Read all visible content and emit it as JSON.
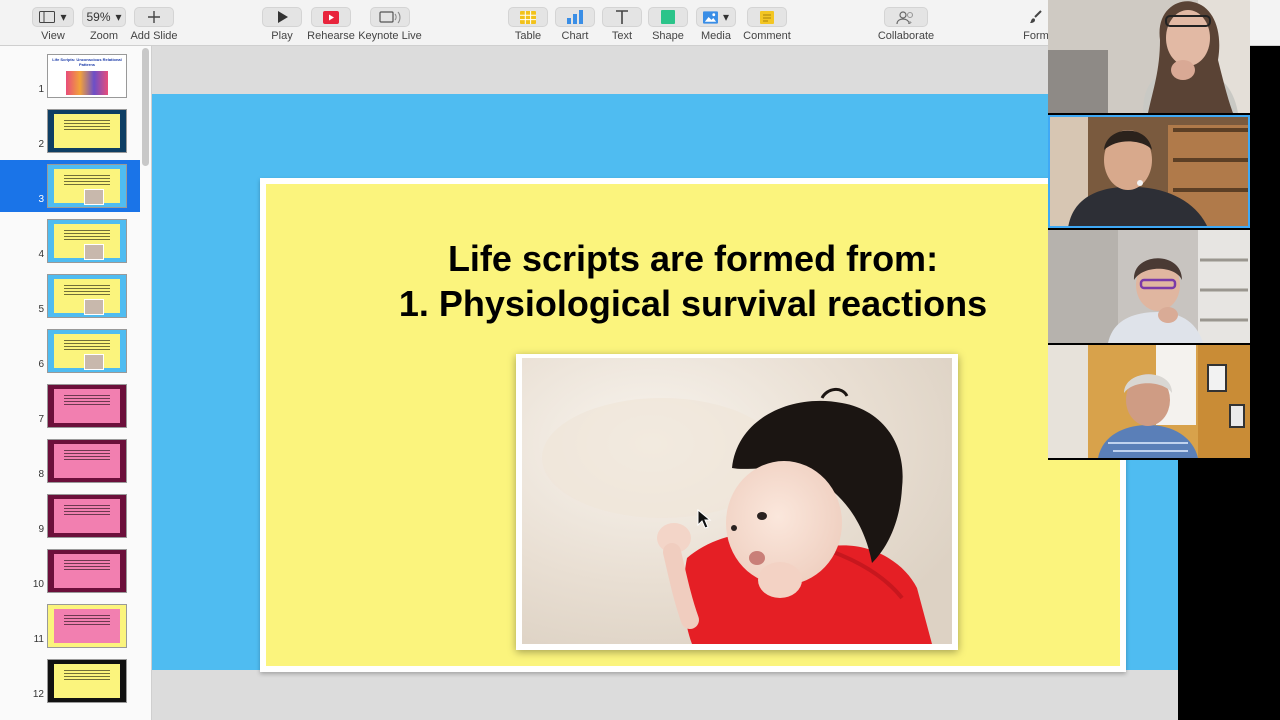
{
  "toolbar": {
    "view": {
      "label": "View",
      "icon": "sidebar-view-icon"
    },
    "zoom": {
      "label": "Zoom",
      "value": "59%",
      "icon": "chevron-down-icon"
    },
    "add_slide": {
      "label": "Add Slide",
      "icon": "plus-icon"
    },
    "play": {
      "label": "Play",
      "icon": "play-icon"
    },
    "rehearse": {
      "label": "Rehearse",
      "icon": "rehearse-icon"
    },
    "keynote_live": {
      "label": "Keynote Live",
      "icon": "keynote-live-icon"
    },
    "table": {
      "label": "Table",
      "icon": "table-icon"
    },
    "chart": {
      "label": "Chart",
      "icon": "chart-icon"
    },
    "text": {
      "label": "Text",
      "icon": "text-icon"
    },
    "shape": {
      "label": "Shape",
      "icon": "shape-icon"
    },
    "media": {
      "label": "Media",
      "icon": "media-icon"
    },
    "comment": {
      "label": "Comment",
      "icon": "comment-icon"
    },
    "collaborate": {
      "label": "Collaborate",
      "icon": "collaborate-icon"
    },
    "format": {
      "label": "Form",
      "icon": "paintbrush-icon"
    }
  },
  "colors": {
    "accent_blue": "#1a74e8",
    "slide_background": "#4fbcf1",
    "slide_yellow": "#fbf47d",
    "pink_slide": "#f27fb0",
    "rehearse_red": "#e8243c",
    "table_yellow": "#f2c21b",
    "chart_blue": "#3a8ee6",
    "shape_green": "#2bc48a",
    "comment_yellow": "#f3c623"
  },
  "navigator": {
    "selected": 3,
    "slides": [
      {
        "number": "1",
        "title": "Life Scripts: Unconscious Relational Patterns",
        "style": "title"
      },
      {
        "number": "2",
        "style": "yellow-dark"
      },
      {
        "number": "3",
        "style": "yellow-blue"
      },
      {
        "number": "4",
        "style": "yellow-blue"
      },
      {
        "number": "5",
        "style": "yellow-blue"
      },
      {
        "number": "6",
        "style": "yellow-blue"
      },
      {
        "number": "7",
        "style": "pink-dark"
      },
      {
        "number": "8",
        "style": "pink-dark"
      },
      {
        "number": "9",
        "style": "pink-dark"
      },
      {
        "number": "10",
        "style": "pink-dark"
      },
      {
        "number": "11",
        "style": "pink-light"
      },
      {
        "number": "12",
        "style": "black-yellow"
      }
    ]
  },
  "slide": {
    "title_line1": "Life scripts are formed from:",
    "title_line2": "1. Physiological survival reactions"
  }
}
